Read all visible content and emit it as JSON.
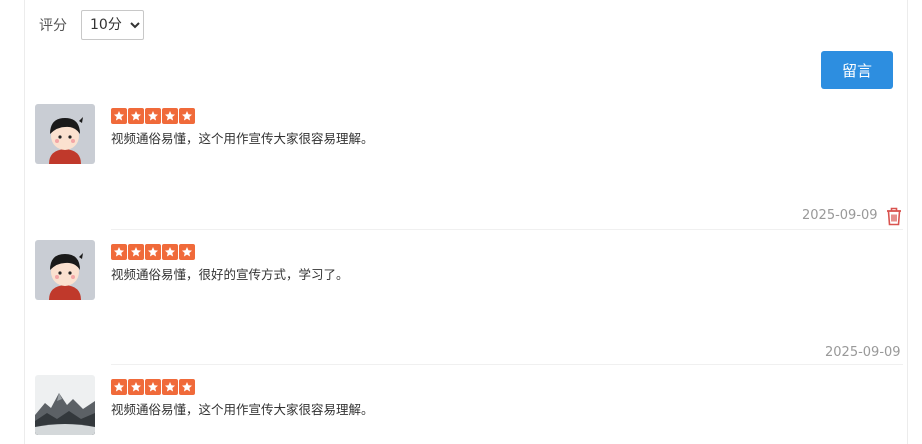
{
  "rating": {
    "label": "评分",
    "selected": "10分"
  },
  "submit_label": "留言",
  "comments": [
    {
      "avatar": "cartoon-boy-avatar",
      "stars": 5,
      "text": "视频通俗易懂，这个用作宣传大家很容易理解。",
      "date": "2025-09-09",
      "deletable": true
    },
    {
      "avatar": "cartoon-boy-avatar",
      "stars": 5,
      "text": "视频通俗易懂，很好的宣传方式，学习了。",
      "date": "2025-09-09",
      "deletable": false
    },
    {
      "avatar": "ink-landscape-avatar",
      "stars": 5,
      "text": "视频通俗易懂，这个用作宣传大家很容易理解。"
    }
  ],
  "colors": {
    "star": "#f06a3a",
    "button": "#2d8ee0",
    "delete": "#d9534f",
    "date": "#999999"
  },
  "icons": {
    "star": "star-icon",
    "delete": "trash-icon"
  }
}
